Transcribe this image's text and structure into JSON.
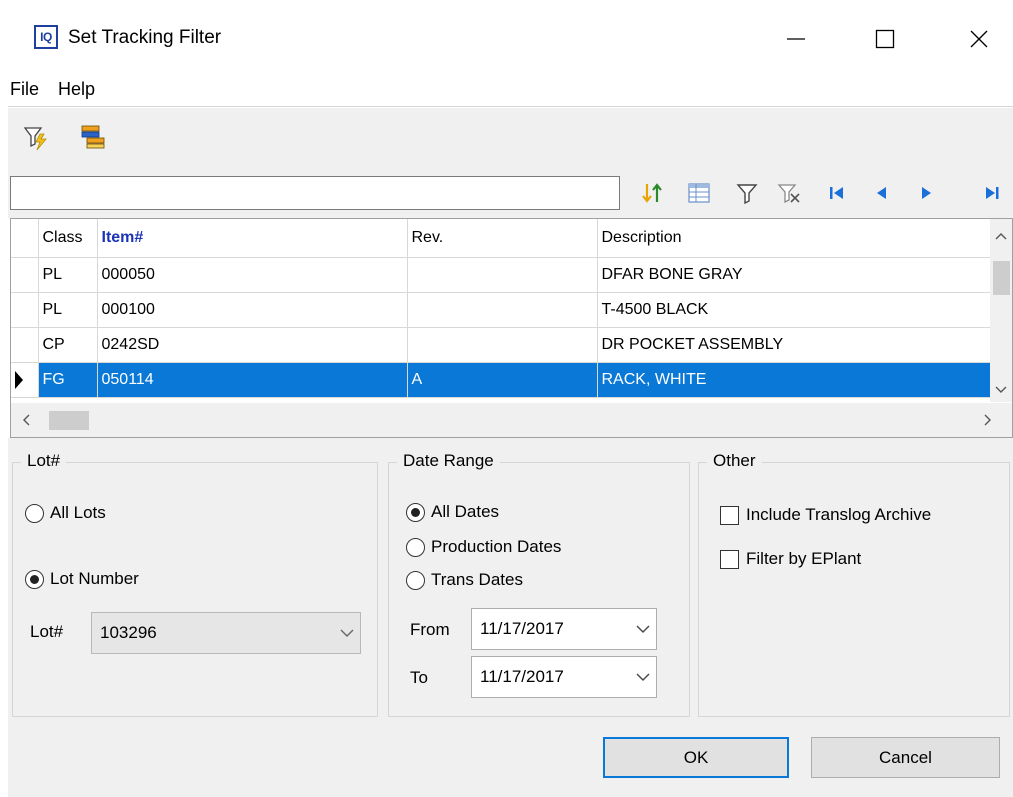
{
  "window": {
    "logo_text": "IQ",
    "title": "Set Tracking Filter"
  },
  "menu": {
    "items": [
      {
        "label": "File"
      },
      {
        "label": "Help"
      }
    ]
  },
  "toolbar": {
    "icons": [
      "lightning-filter-icon",
      "report-icon"
    ]
  },
  "search": {
    "value": "",
    "placeholder": ""
  },
  "nav_icons": [
    "sort-icon",
    "grid-icon",
    "filter-icon",
    "clear-filter-icon",
    "first-record-icon",
    "prior-record-icon",
    "next-record-icon",
    "last-record-icon"
  ],
  "grid": {
    "columns": [
      "Class",
      "Item#",
      "Rev.",
      "Description"
    ],
    "sorted_column": "Item#",
    "rows": [
      {
        "class": "PL",
        "item": "000050",
        "rev": "",
        "description": "DFAR BONE GRAY"
      },
      {
        "class": "PL",
        "item": "000100",
        "rev": "",
        "description": "T-4500 BLACK"
      },
      {
        "class": "CP",
        "item": "0242SD",
        "rev": "",
        "description": "DR POCKET ASSEMBLY"
      },
      {
        "class": "FG",
        "item": "050114",
        "rev": "A",
        "description": "RACK, WHITE"
      }
    ],
    "selected_row": 3
  },
  "lot_group": {
    "title": "Lot#",
    "all_lots": "All Lots",
    "lot_number": "Lot Number",
    "lot_label": "Lot#",
    "lot_value": "103296",
    "selected": "lot_number"
  },
  "date_group": {
    "title": "Date Range",
    "all_dates": "All Dates",
    "production_dates": "Production Dates",
    "trans_dates": "Trans Dates",
    "from_label": "From",
    "from_value": "11/17/2017",
    "to_label": "To",
    "to_value": "11/17/2017",
    "selected": "all_dates"
  },
  "other_group": {
    "title": "Other",
    "include_translog": "Include Translog Archive",
    "filter_eplant": "Filter by EPlant"
  },
  "buttons": {
    "ok": "OK",
    "cancel": "Cancel"
  },
  "colors": {
    "selection": "#0a78d7",
    "accent_text": "#1c33b7",
    "nav_arrow": "#1a6fd8"
  }
}
